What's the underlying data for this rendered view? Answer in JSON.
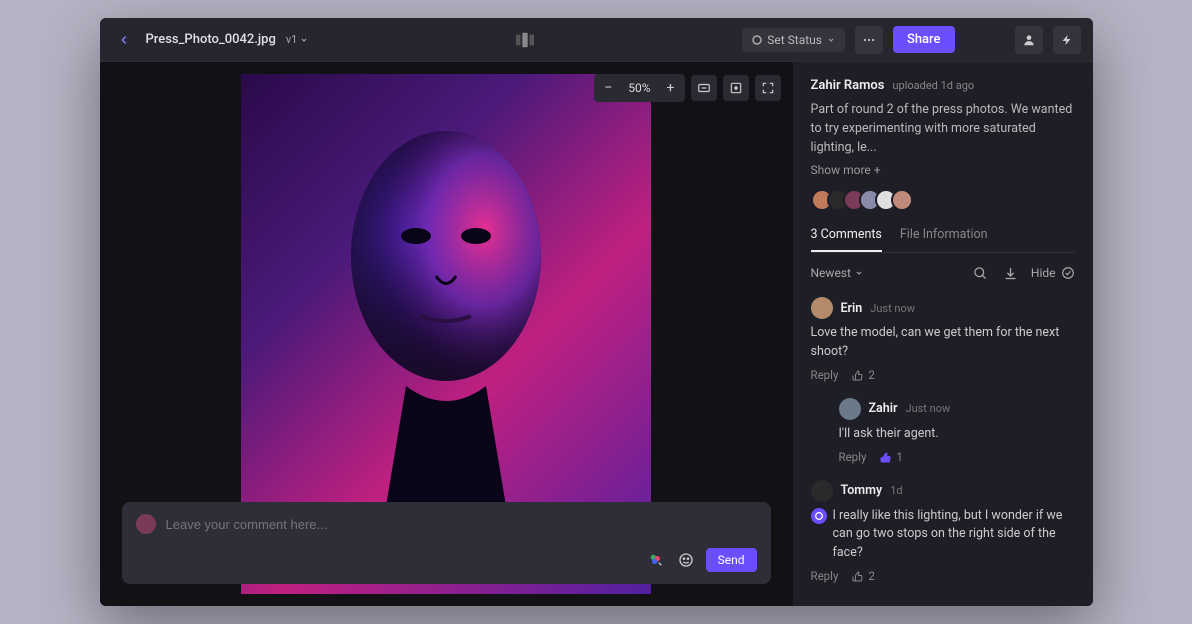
{
  "header": {
    "filename": "Press_Photo_0042.jpg",
    "version": "v1",
    "status_label": "Set Status",
    "share_label": "Share"
  },
  "viewer": {
    "zoom": "50%"
  },
  "comment_input": {
    "placeholder": "Leave your comment here...",
    "send_label": "Send"
  },
  "details": {
    "uploader": "Zahir Ramos",
    "uploaded_time": "uploaded 1d ago",
    "description": "Part of round 2 of the press photos. We wanted to try experimenting with more saturated lighting, le...",
    "show_more": "Show more +"
  },
  "tabs": {
    "comments_label": "3 Comments",
    "fileinfo_label": "File Information"
  },
  "filters": {
    "sort_label": "Newest",
    "hide_label": "Hide"
  },
  "comments": [
    {
      "author": "Erin",
      "time": "Just now",
      "body": "Love the model, can we get them for the next shoot?",
      "reply_label": "Reply",
      "likes": "2",
      "avatar_bg": "#b58a6a",
      "liked": false,
      "nested": false,
      "marker": false
    },
    {
      "author": "Zahir",
      "time": "Just now",
      "body": "I'll ask their agent.",
      "reply_label": "Reply",
      "likes": "1",
      "avatar_bg": "#6a7a8a",
      "liked": true,
      "nested": true,
      "marker": false
    },
    {
      "author": "Tommy",
      "time": "1d",
      "body": "I really like this lighting, but I wonder if we can go two stops on the right side of the face?",
      "reply_label": "Reply",
      "likes": "2",
      "avatar_bg": "#2a2a2a",
      "liked": false,
      "nested": false,
      "marker": true
    }
  ],
  "collaborators": [
    {
      "bg": "#c07a5a"
    },
    {
      "bg": "#2a2a2a"
    },
    {
      "bg": "#7a3a5a"
    },
    {
      "bg": "#8a8aaa"
    },
    {
      "bg": "#e0e0e0"
    },
    {
      "bg": "#c08a7a"
    }
  ]
}
